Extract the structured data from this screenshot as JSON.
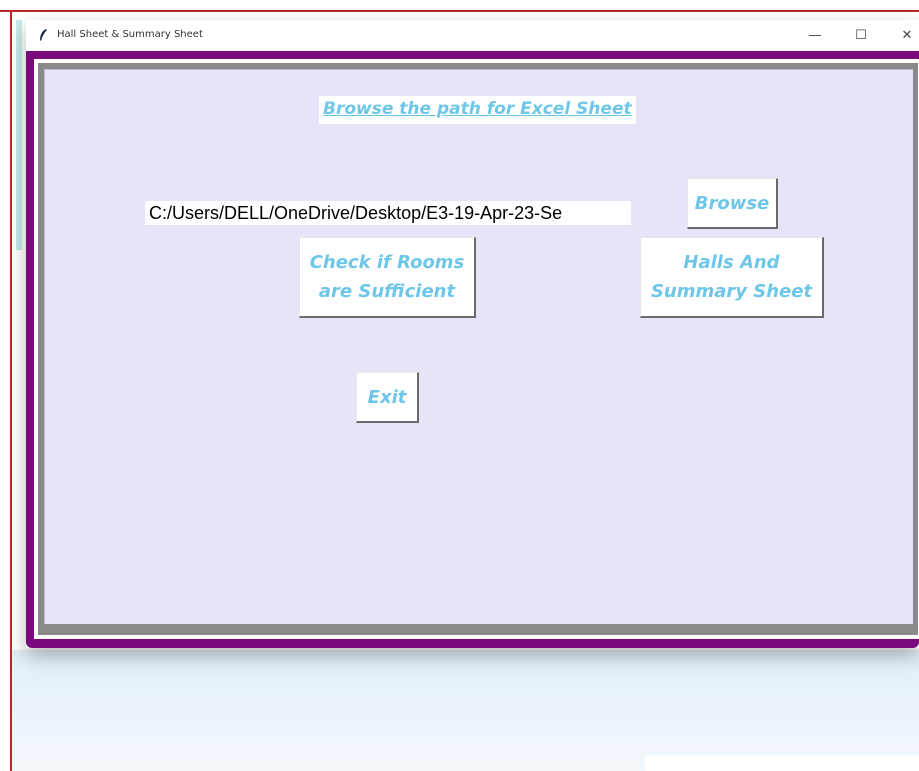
{
  "window": {
    "title": "Hall Sheet & Summary Sheet",
    "app_icon": "feather-icon",
    "controls": {
      "minimize": "—",
      "maximize": "☐",
      "close": "✕"
    }
  },
  "main": {
    "heading": "Browse the path for Excel Sheet",
    "path_value": "C:/Users/DELL/OneDrive/Desktop/E3-19-Apr-23-Se",
    "buttons": {
      "browse": "Browse",
      "check_rooms": "Check if Rooms\nare Sufficient",
      "halls_summary": "Halls And\nSummary Sheet",
      "exit": "Exit"
    }
  },
  "colors": {
    "frame_purple": "#7b097b",
    "panel_bg": "#e5e5f7",
    "text_accent": "#6ec6e8"
  }
}
